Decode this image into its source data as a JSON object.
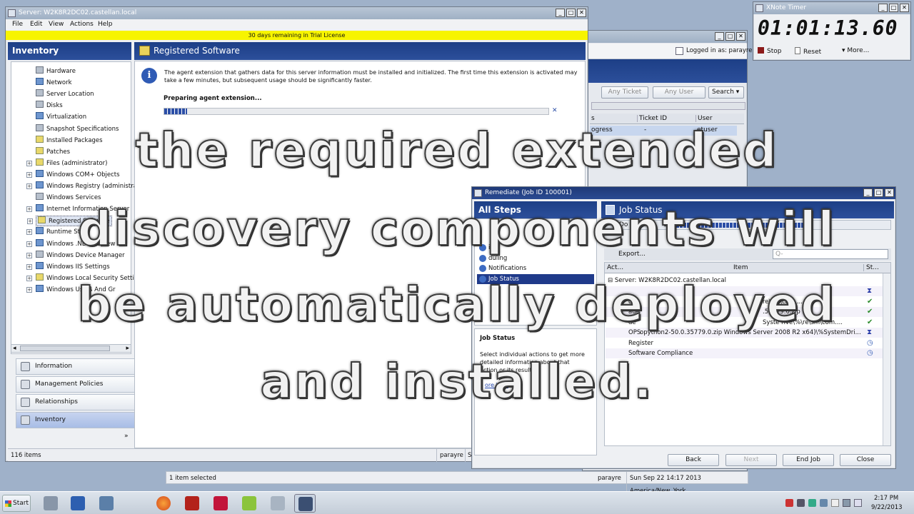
{
  "main_window": {
    "title": "Server: W2K8R2DC02.castellan.local",
    "menu": [
      "File",
      "Edit",
      "View",
      "Actions",
      "Help"
    ],
    "license_bar": "30 days remaining in Trial License",
    "inventory_header": "Inventory",
    "tree": [
      {
        "label": "Hardware",
        "icon": "hardware-icon",
        "expand": false
      },
      {
        "label": "Network",
        "icon": "network-icon",
        "expand": false
      },
      {
        "label": "Server Location",
        "icon": "location-icon",
        "expand": false
      },
      {
        "label": "Disks",
        "icon": "disk-icon",
        "expand": false
      },
      {
        "label": "Virtualization",
        "icon": "virtualization-icon",
        "expand": false
      },
      {
        "label": "Snapshot Specifications",
        "icon": "snapshot-icon",
        "expand": false
      },
      {
        "label": "Installed Packages",
        "icon": "package-icon",
        "expand": false
      },
      {
        "label": "Patches",
        "icon": "patch-icon",
        "expand": false
      },
      {
        "label": "Files (administrator)",
        "icon": "folder-icon",
        "expand": true
      },
      {
        "label": "Windows COM+ Objects",
        "icon": "com-icon",
        "expand": true
      },
      {
        "label": "Windows Registry (administrator)",
        "icon": "registry-icon",
        "expand": true
      },
      {
        "label": "Windows Services",
        "icon": "services-icon",
        "expand": false
      },
      {
        "label": "Internet Information Server",
        "icon": "iis-icon",
        "expand": true
      },
      {
        "label": "Registered Software",
        "icon": "software-icon",
        "expand": true,
        "selected": true
      },
      {
        "label": "Runtime State",
        "icon": "runtime-icon",
        "expand": true
      },
      {
        "label": "Windows .NET Framew",
        "icon": "dotnet-icon",
        "expand": true
      },
      {
        "label": "Windows Device Manager",
        "icon": "device-icon",
        "expand": true
      },
      {
        "label": "Windows IIS Settings",
        "icon": "iis-settings-icon",
        "expand": true
      },
      {
        "label": "Windows Local Security Settings",
        "icon": "security-icon",
        "expand": true
      },
      {
        "label": "Windows Users And Gr",
        "icon": "users-icon",
        "expand": true
      }
    ],
    "nav_buttons": [
      "Information",
      "Management Policies",
      "Relationships",
      "Inventory"
    ],
    "content_title": "Registered Software",
    "info_text": "The agent extension that gathers data for this server information must be installed and initialized.  The first time this extension is activated may take a few minutes, but subsequent usage should be significantly faster.",
    "preparing_text": "Preparing agent extension...",
    "progress": 0.06,
    "status_items": "116 items",
    "status_user": "parayre",
    "status_s": "S"
  },
  "back_window": {
    "logged_in": "Logged in as: parayre",
    "filters": [
      "Any Ticket",
      "Any User",
      "Search"
    ],
    "columns": [
      "s",
      "Ticket ID",
      "User"
    ],
    "row": {
      "status": "ogress",
      "ticket": "-",
      "user": "etuser"
    },
    "status_selected": "1 item selected",
    "status_user": "parayre",
    "status_date": "Sun Sep 22 14:17 2013 America/New_York"
  },
  "timer": {
    "title": "XNote Timer",
    "value": "01:01:13.60",
    "stop": "Stop",
    "reset": "Reset",
    "more": "More..."
  },
  "remediate": {
    "title": "Remediate (Job ID 100001)",
    "all_steps": "All Steps",
    "job_status_header": "Job Status",
    "steps": [
      {
        "label": "iew",
        "icon": "view-icon"
      },
      {
        "label": "duling",
        "icon": "schedule-icon"
      },
      {
        "label": "Notifications",
        "icon": "notification-icon"
      },
      {
        "label": "Job Status",
        "icon": "job-status-icon",
        "selected": true
      }
    ],
    "help_title": "Job Status",
    "help_text": "Select individual actions to get more detailed information about that action or its results.",
    "help_link": "ore help",
    "toolbar_text": "Do",
    "export": "Export...",
    "search_placeholder": "Q-",
    "grid_columns": [
      "Act...",
      "Item",
      "St..."
    ],
    "server_row": "Server: W2K8R2DC02.castellan.local",
    "rows": [
      {
        "action": "",
        "item": "",
        "status": "hourglass"
      },
      {
        "action": "de",
        "item": "re\\sm\\com....",
        "status": "check"
      },
      {
        "action": "ade",
        "item": ".57779.0.zip",
        "status": "check"
      },
      {
        "action": "de",
        "item": "Syste  rive\\%\\re\\sm\\com....",
        "status": "check"
      },
      {
        "action": "OPS",
        "item": "opython2-50.0.35779.0.zip  Windows Server 2008 R2 x64)\\%SystemDri...",
        "status": "hourglass"
      },
      {
        "action": "Register",
        "item": "",
        "status": "clock"
      },
      {
        "action": "Software Compliance",
        "item": "",
        "status": "clock"
      }
    ],
    "buttons": {
      "back": "Back",
      "next": "Next",
      "end_job": "End Job",
      "close": "Close"
    }
  },
  "overlay": [
    "the required extended",
    "discovery components will",
    "be automatically deployed",
    "and installed."
  ],
  "taskbar": {
    "start": "Start",
    "time": "2:17 PM",
    "date": "9/22/2013"
  },
  "colors": {
    "header_blue": "#1d3f86",
    "license_yellow": "#f7f400",
    "selection": "#3366cc"
  }
}
